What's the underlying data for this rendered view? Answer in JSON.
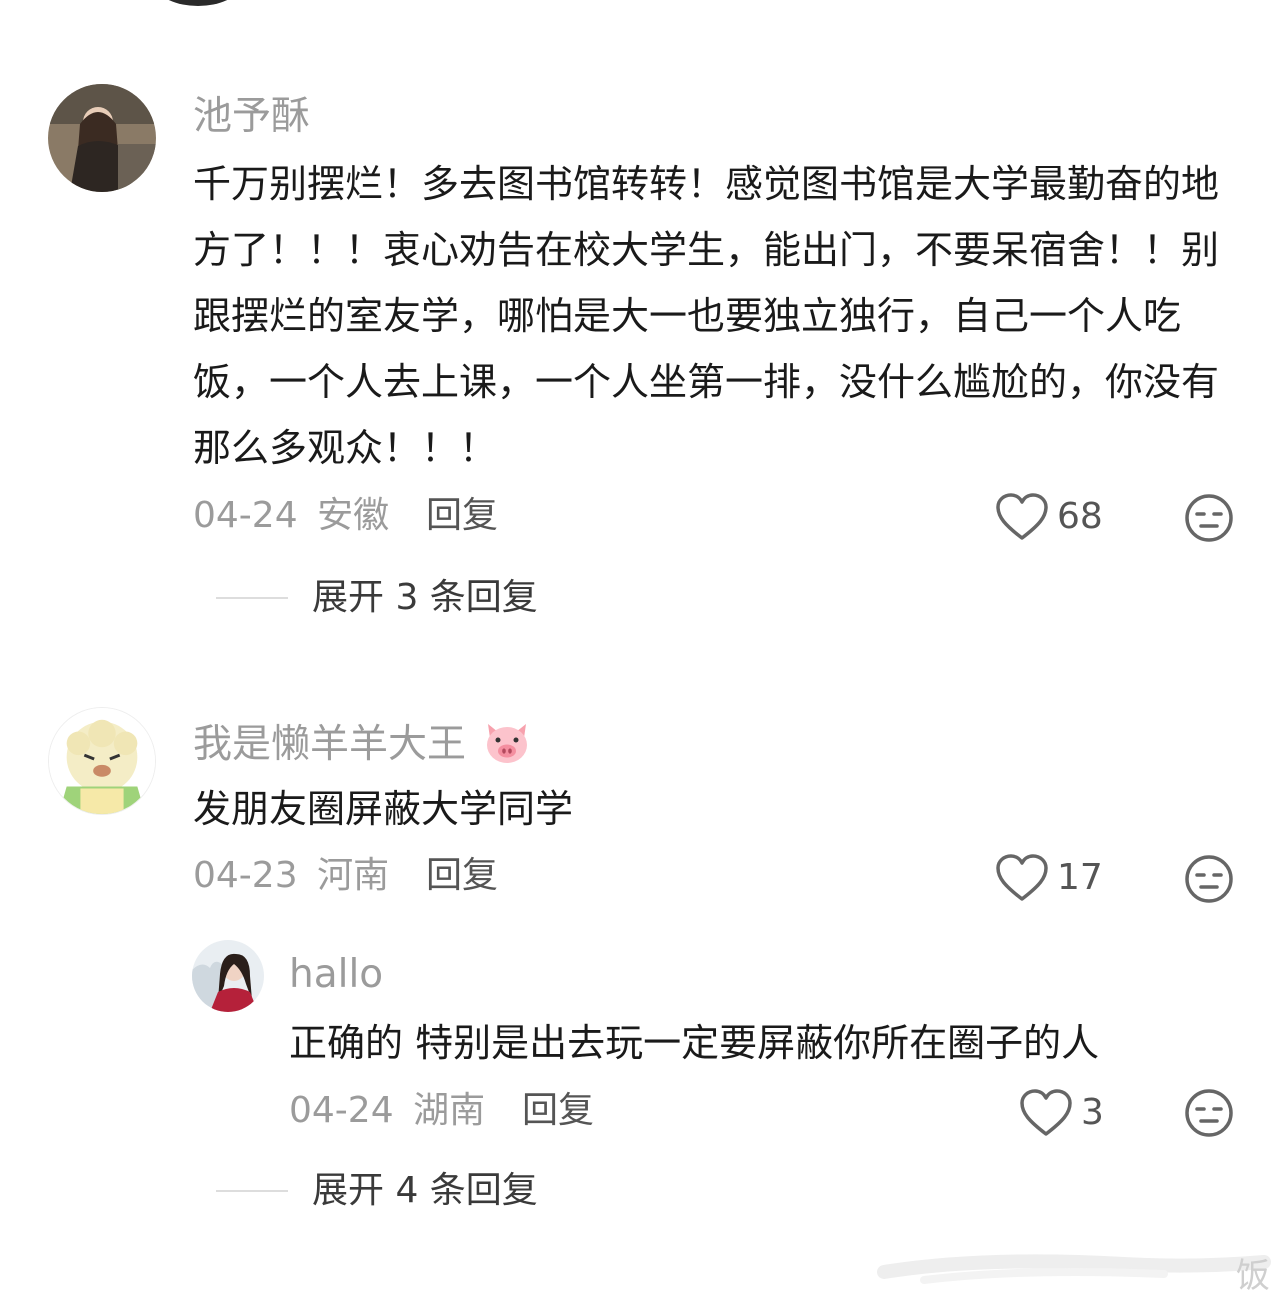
{
  "comments": [
    {
      "username": "池予酥",
      "text": "千万别摆烂！多去图书馆转转！感觉图书馆是大学最勤奋的地方了！！！衷心劝告在校大学生，能出门，不要呆宿舍！！别跟摆烂的室友学，哪怕是大一也要独立独行，自己一个人吃饭，一个人去上课，一个人坐第一排，没什么尴尬的，你没有那么多观众！！！",
      "date": "04-24",
      "location": "安徽",
      "reply_label": "回复",
      "likes": "68",
      "expand_label": "展开 3 条回复"
    },
    {
      "username": "我是懒羊羊大王",
      "username_emoji": "pig-face-emoji",
      "text": "发朋友圈屏蔽大学同学",
      "date": "04-23",
      "location": "河南",
      "reply_label": "回复",
      "likes": "17",
      "reply": {
        "username": "hallo",
        "text": "正确的 特别是出去玩一定要屏蔽你所在圈子的人",
        "date": "04-24",
        "location": "湖南",
        "reply_label": "回复",
        "likes": "3"
      },
      "expand_label": "展开 4 条回复"
    }
  ],
  "watermark": "饭",
  "icons": {
    "like": "heart-outline-icon",
    "dislike": "meh-face-icon"
  },
  "colors": {
    "secondary_text": "#9b9b9b",
    "primary_text": "#1a1a1a"
  }
}
